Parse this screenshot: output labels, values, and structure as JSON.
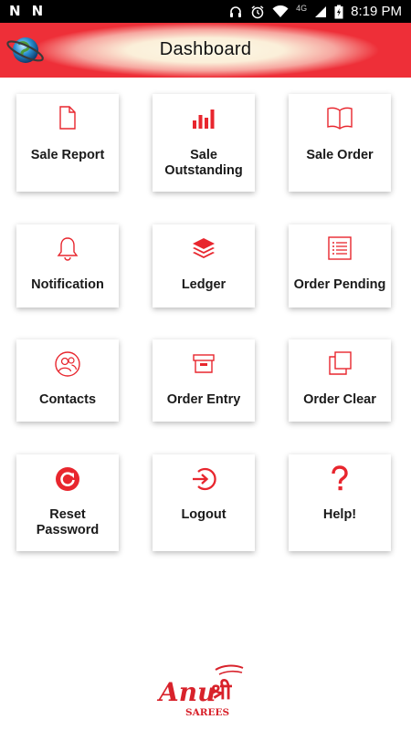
{
  "status_bar": {
    "left_icons": [
      "N",
      "N"
    ],
    "network": "4G",
    "time": "8:19 PM"
  },
  "header": {
    "title": "Dashboard"
  },
  "tiles": [
    {
      "label": "Sale Report",
      "icon": "document-icon"
    },
    {
      "label": "Sale Outstanding",
      "icon": "bar-chart-icon"
    },
    {
      "label": "Sale Order",
      "icon": "open-book-icon"
    },
    {
      "label": "Notification",
      "icon": "bell-icon"
    },
    {
      "label": "Ledger",
      "icon": "layers-icon"
    },
    {
      "label": "Order Pending",
      "icon": "list-icon"
    },
    {
      "label": "Contacts",
      "icon": "contacts-icon"
    },
    {
      "label": "Order Entry",
      "icon": "archive-box-icon"
    },
    {
      "label": "Order Clear",
      "icon": "copy-icon"
    },
    {
      "label": "Reset Password",
      "icon": "reset-icon"
    },
    {
      "label": "Logout",
      "icon": "sign-in-icon"
    },
    {
      "label": "Help!",
      "icon": "question-icon"
    }
  ],
  "brand": {
    "name": "Anu",
    "script": "श्री",
    "tagline": "SAREES"
  },
  "colors": {
    "accent": "#e8262e",
    "header_red": "#ee2f38",
    "status_bar": "#000000"
  }
}
